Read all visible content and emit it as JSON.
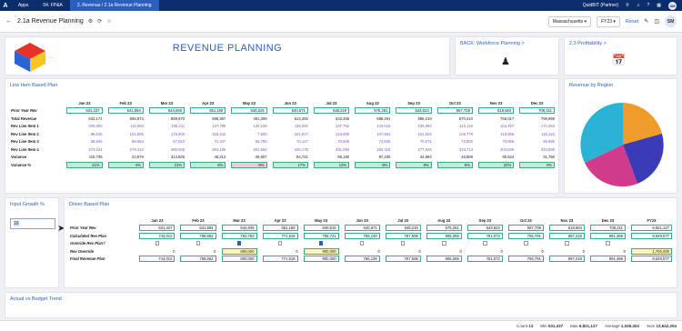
{
  "topbar": {
    "logo": "A",
    "crumbs": [
      "Apps",
      "04. FP&A",
      "2. Revenue / 2.1a Revenue Planning"
    ],
    "workspace": "QuidBIT (Partner)",
    "avatar": "SM"
  },
  "subbar": {
    "page_title": "2.1a Revenue Planning",
    "region_select": "Massachusetts",
    "year_select": "FY23",
    "reset_label": "Reset",
    "avatar": "SM"
  },
  "header_cards": {
    "main_title": "REVENUE PLANNING",
    "back_link": "BACK: Workforce Planning >",
    "profit_link": "2.3 Profitability >"
  },
  "line_item": {
    "title": "Line Item Based Plan",
    "months": [
      "Jan 23",
      "Feb 23",
      "Mar 23",
      "Apr 23",
      "May 23",
      "Jun 23",
      "Jul 23",
      "Aug 23",
      "Sep 23",
      "Oct 23",
      "Nov 23",
      "Dec 23"
    ],
    "rows": [
      {
        "label": "Prior Year Rev",
        "values": [
          "531,437",
          "541,894",
          "544,845",
          "551,156",
          "540,515",
          "540,671",
          "548,219",
          "575,261",
          "543,623",
          "567,708",
          "619,584",
          "708,211"
        ]
      },
      {
        "label": "Total Revenue",
        "values": [
          "642,172",
          "565,873",
          "859,670",
          "596,367",
          "491,008",
          "613,392",
          "622,450",
          "586,291",
          "586,219",
          "670,410",
          "755,017",
          "706,969"
        ]
      },
      {
        "label": "Rev Line Item 1",
        "values": [
          "200,000",
          "115,000",
          "136,211",
          "137,795",
          "135,129",
          "116,040",
          "137,752",
          "143,615",
          "135,994",
          "112,116",
          "154,457",
          "171,053"
        ]
      },
      {
        "label": "Rev Line Item 2",
        "values": [
          "99,645",
          "101,605",
          "175,000",
          "103,242",
          "7,500",
          "101,047",
          "123,000",
          "107,861",
          "101,929",
          "109,779",
          "116,856",
          "115,122"
        ]
      },
      {
        "label": "Rev Line Item 3",
        "values": [
          "68,506",
          "69,654",
          "67,523",
          "71,347",
          "66,795",
          "70,127",
          "70,605",
          "74,505",
          "70,671",
          "73,802",
          "79,856",
          "86,989"
        ]
      },
      {
        "label": "Rev Line Item 4",
        "values": [
          "274,021",
          "279,414",
          "480,936",
          "284,105",
          "281,584",
          "326,178",
          "291,093",
          "260,315",
          "277,625",
          "319,713",
          "403,849",
          "333,806"
        ]
      },
      {
        "label": "Variance",
        "values": [
          "110,735",
          "23,979",
          "314,825",
          "45,212",
          "-49,507",
          "94,721",
          "65,180",
          "87,430",
          "44,994",
          "48,589",
          "90,524",
          "31,760"
        ]
      },
      {
        "label": "Variance %",
        "values": [
          "21%",
          "4%",
          "21%",
          "8%",
          "-9%",
          "17%",
          "12%",
          "8%",
          "8%",
          "8%",
          "22%",
          "0%"
        ]
      }
    ]
  },
  "pie": {
    "title": "Revenue by Region"
  },
  "input_growth": {
    "title": "Input Growth %",
    "value": "10"
  },
  "driver": {
    "title": "Driver Based Plan",
    "months": [
      "Jan 23",
      "Feb 23",
      "Mar 23",
      "Apr 23",
      "May 23",
      "Jun 23",
      "Jul 23",
      "Aug 23",
      "Sep 23",
      "Oct 23",
      "Nov 23",
      "Dec 23",
      "FY23"
    ],
    "rows": [
      {
        "label": "Prior Year Rev",
        "values": [
          "531,437",
          "541,894",
          "544,845",
          "551,156",
          "540,515",
          "540,671",
          "548,219",
          "575,261",
          "543,623",
          "567,708",
          "619,584",
          "708,211",
          "6,821,127"
        ]
      },
      {
        "label": "Calculated Rev Plan",
        "values": [
          "744,012",
          "758,652",
          "762,783",
          "771,618",
          "756,721",
          "756,139",
          "767,506",
          "805,365",
          "761,072",
          "794,791",
          "867,418",
          "991,496",
          "9,549,577"
        ]
      },
      {
        "label": "Override Rev Plan?",
        "values": [
          "",
          "",
          "",
          "",
          "",
          "",
          "",
          "",
          "",
          "",
          "",
          "",
          ""
        ]
      },
      {
        "label": "Rev Override",
        "values": [
          "0",
          "0",
          "800,000",
          "0",
          "900,000",
          "0",
          "0",
          "0",
          "0",
          "0",
          "0",
          "0",
          "1,700,000"
        ]
      },
      {
        "label": "Final Revenue Plan",
        "values": [
          "744,012",
          "758,652",
          "800,000",
          "771,618",
          "900,000",
          "756,139",
          "767,506",
          "805,365",
          "761,072",
          "794,791",
          "867,418",
          "991,496",
          "9,549,577"
        ]
      }
    ]
  },
  "budget": {
    "title": "Actual vs Budget Trend"
  },
  "status": {
    "count_label": "Count",
    "count": "13",
    "min_label": "Min",
    "min": "531,437",
    "max_label": "Max",
    "max": "6,821,127",
    "avg_label": "Average",
    "avg": "1,049,404",
    "sum_label": "Sum",
    "sum": "13,642,254"
  }
}
